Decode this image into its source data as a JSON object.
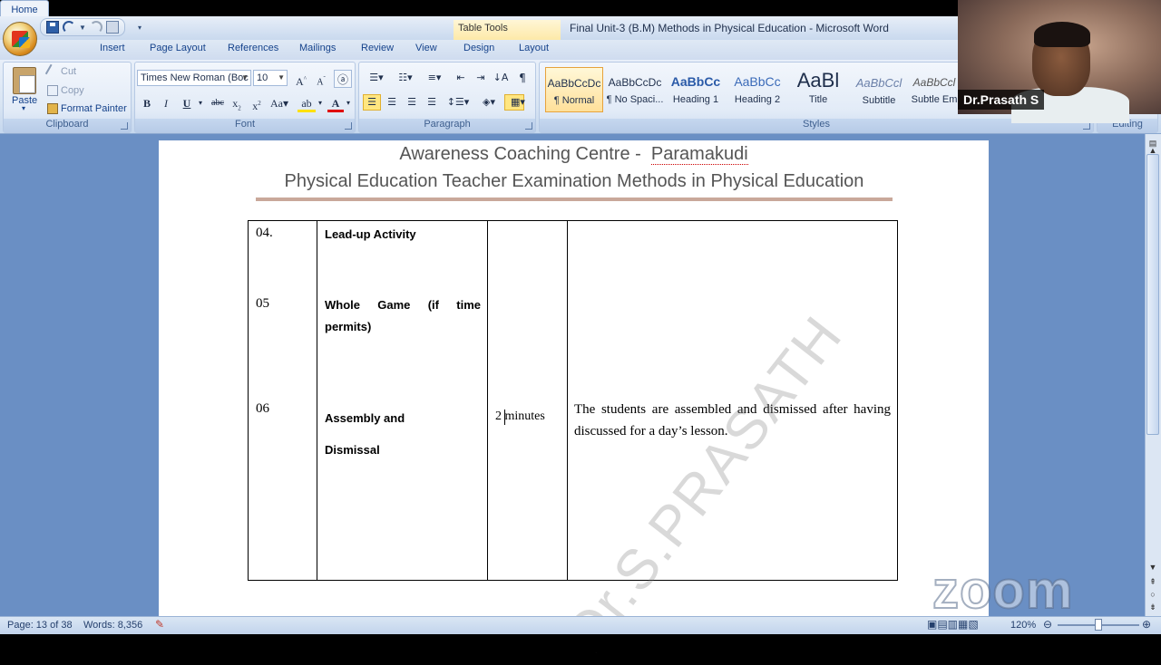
{
  "window": {
    "title": "Final Unit-3  (B.M) Methods in Physical Education  -  Microsoft Word",
    "contextual_tab_group": "Table Tools"
  },
  "tabs": [
    "Home",
    "Insert",
    "Page Layout",
    "References",
    "Mailings",
    "Review",
    "View",
    "Design",
    "Layout"
  ],
  "ribbon": {
    "clipboard": {
      "label": "Clipboard",
      "paste": "Paste",
      "cut": "Cut",
      "copy": "Copy",
      "format_painter": "Format Painter"
    },
    "font": {
      "label": "Font",
      "font_name": "Times New Roman (Boc",
      "font_size": "10"
    },
    "paragraph": {
      "label": "Paragraph"
    },
    "styles": {
      "label": "Styles",
      "items": [
        {
          "sample": "AaBbCcDc",
          "name": "¶ Normal"
        },
        {
          "sample": "AaBbCcDc",
          "name": "¶ No Spaci..."
        },
        {
          "sample": "AaBbCc",
          "name": "Heading 1"
        },
        {
          "sample": "AaBbCc",
          "name": "Heading 2"
        },
        {
          "sample": "AaBl",
          "name": "Title"
        },
        {
          "sample": "AaBbCcl",
          "name": "Subtitle"
        },
        {
          "sample": "AaBbCcl",
          "name": "Subtle Em"
        }
      ]
    },
    "editing": {
      "label": "Editing"
    }
  },
  "document": {
    "header_line1_a": "Awareness Coaching Centre -",
    "header_line1_b": "Paramakudi",
    "header_line2": "Physical Education Teacher Examination Methods in Physical Education",
    "rows": [
      {
        "no": "04.",
        "activity": "Lead-up Activity",
        "time": "",
        "description": ""
      },
      {
        "no": "05",
        "activity_line1": "Whole  Game  (if  time",
        "activity_line2": "permits)",
        "time": "",
        "description": ""
      },
      {
        "no": "06",
        "activity_line1": "Assembly and",
        "activity_line2": "Dismissal",
        "time": "2 minutes",
        "description": "The students are assembled and dismissed after having discussed for a day’s lesson."
      }
    ],
    "watermark": "Dr.S.PRASATH"
  },
  "statusbar": {
    "page": "Page: 13 of 38",
    "words": "Words: 8,356",
    "zoom": "120%"
  },
  "overlay": {
    "presenter_name": "Dr.Prasath S",
    "zoom_logo": "zoom"
  },
  "colors": {
    "ribbon_bg": "#d9e5f3",
    "doc_bg": "#6a8fc4",
    "accent": "#15428b"
  }
}
